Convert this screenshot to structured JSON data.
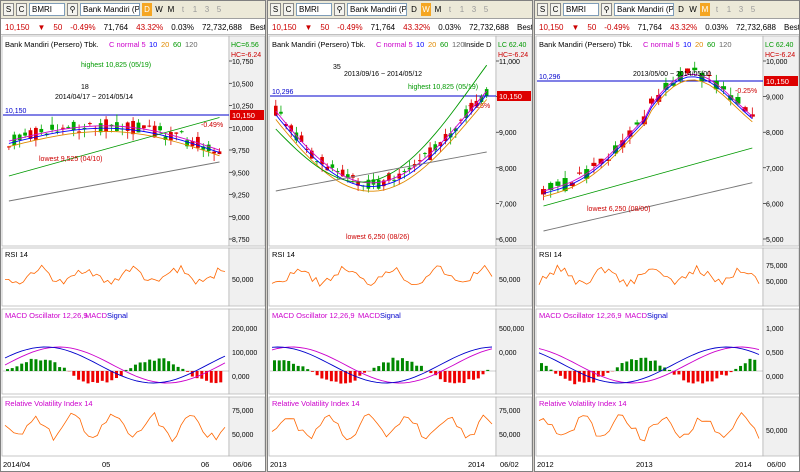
{
  "common": {
    "symbol": "BMRI",
    "btn_s": "S",
    "btn_c": "C",
    "company": "Bank Mandiri (P",
    "last_price": "10,150",
    "change": "50",
    "change_pct": "-0.49%",
    "volume": "71,764",
    "turnover_pct": "43.32%",
    "small_pct": "0.03%",
    "value": "72,732,688",
    "best_label": "Best",
    "periods": [
      "D",
      "W",
      "M",
      "t",
      "1",
      "3",
      "5"
    ],
    "up_color": "#00aa00",
    "down_color": "#dd0000",
    "price_tag": "10,150",
    "rsi_label": "RSI 14",
    "macd_label": "MACD Oscillator 12,26,9",
    "macd_macd": "MACD",
    "macd_signal": "Signal",
    "rvi_label": "Relative Volatility Index 14"
  },
  "panels": [
    {
      "active_period": "D",
      "price_title": "Bank Mandiri (Persero) Tbk.",
      "ma_label": "C normal 5",
      "ma_periods": [
        "10",
        "20",
        "60",
        "120"
      ],
      "hc": "HC=6.56",
      "lc": "HC=-6.24",
      "note_high": "highest 10,825 (05/19)",
      "note_low": "lowest 9,525 (04/10)",
      "note_count": "18",
      "note_range": "2014/04/17 ~ 2014/05/14",
      "hline_label": "10,150",
      "side_pct": "-0.49%",
      "price_ticks": [
        "10,750",
        "10,500",
        "10,250",
        "10,000",
        "9,750",
        "9,500",
        "9,250",
        "9,000",
        "8,750"
      ],
      "rsi_ticks": [
        "50,000"
      ],
      "macd_ticks": [
        "200,000",
        "100,000",
        "0,000"
      ],
      "rvi_ticks": [
        "75,000",
        "50,000"
      ],
      "x_labels": [
        "2014/04",
        "05",
        "06",
        "06/06"
      ]
    },
    {
      "active_period": "W",
      "price_title": "Bank Mandiri (Persero) Tbk.",
      "ma_label": "C normal 5",
      "ma_periods": [
        "10",
        "20",
        "60",
        "120",
        "Inside D"
      ],
      "hc": "LC 62.40",
      "lc": "HC=-6.24",
      "note_high": "highest 10,825 (05/19)",
      "note_low": "lowest 6,250 (08/26)",
      "note_count": "35",
      "note_range": "2013/09/16 ~ 2014/05/12",
      "hline_label": "10,296",
      "side_pct": "-0.25%",
      "price_ticks": [
        "11,000",
        "10,000",
        "9,000",
        "8,000",
        "7,000",
        "6,000"
      ],
      "rsi_ticks": [
        "50,000"
      ],
      "macd_ticks": [
        "500,000",
        "0,000"
      ],
      "rvi_ticks": [
        "75,000",
        "50,000"
      ],
      "x_labels": [
        "2013",
        "2014",
        "06/02"
      ]
    },
    {
      "active_period": "M",
      "price_title": "Bank Mandiri (Persero) Tbk.",
      "ma_label": "C normal 5",
      "ma_periods": [
        "10",
        "20",
        "60",
        "120"
      ],
      "hc": "LC 62.40",
      "lc": "HC=-6.24",
      "note_high": "highest 10,825 (05/19)",
      "note_low": "lowest 6,250 (08/00)",
      "note_count": "",
      "note_range": "2013/05/00 ~ 2014/05/00",
      "hline_label": "10,296",
      "side_pct": "-0.25%",
      "price_ticks": [
        "10,000",
        "9,000",
        "8,000",
        "7,000",
        "6,000",
        "5,000"
      ],
      "rsi_ticks": [
        "75,000",
        "50,000"
      ],
      "macd_ticks": [
        "1,000",
        "0,500",
        "0,000"
      ],
      "rvi_ticks": [
        "50,000"
      ],
      "x_labels": [
        "2012",
        "2013",
        "2014",
        "06/00"
      ]
    }
  ]
}
